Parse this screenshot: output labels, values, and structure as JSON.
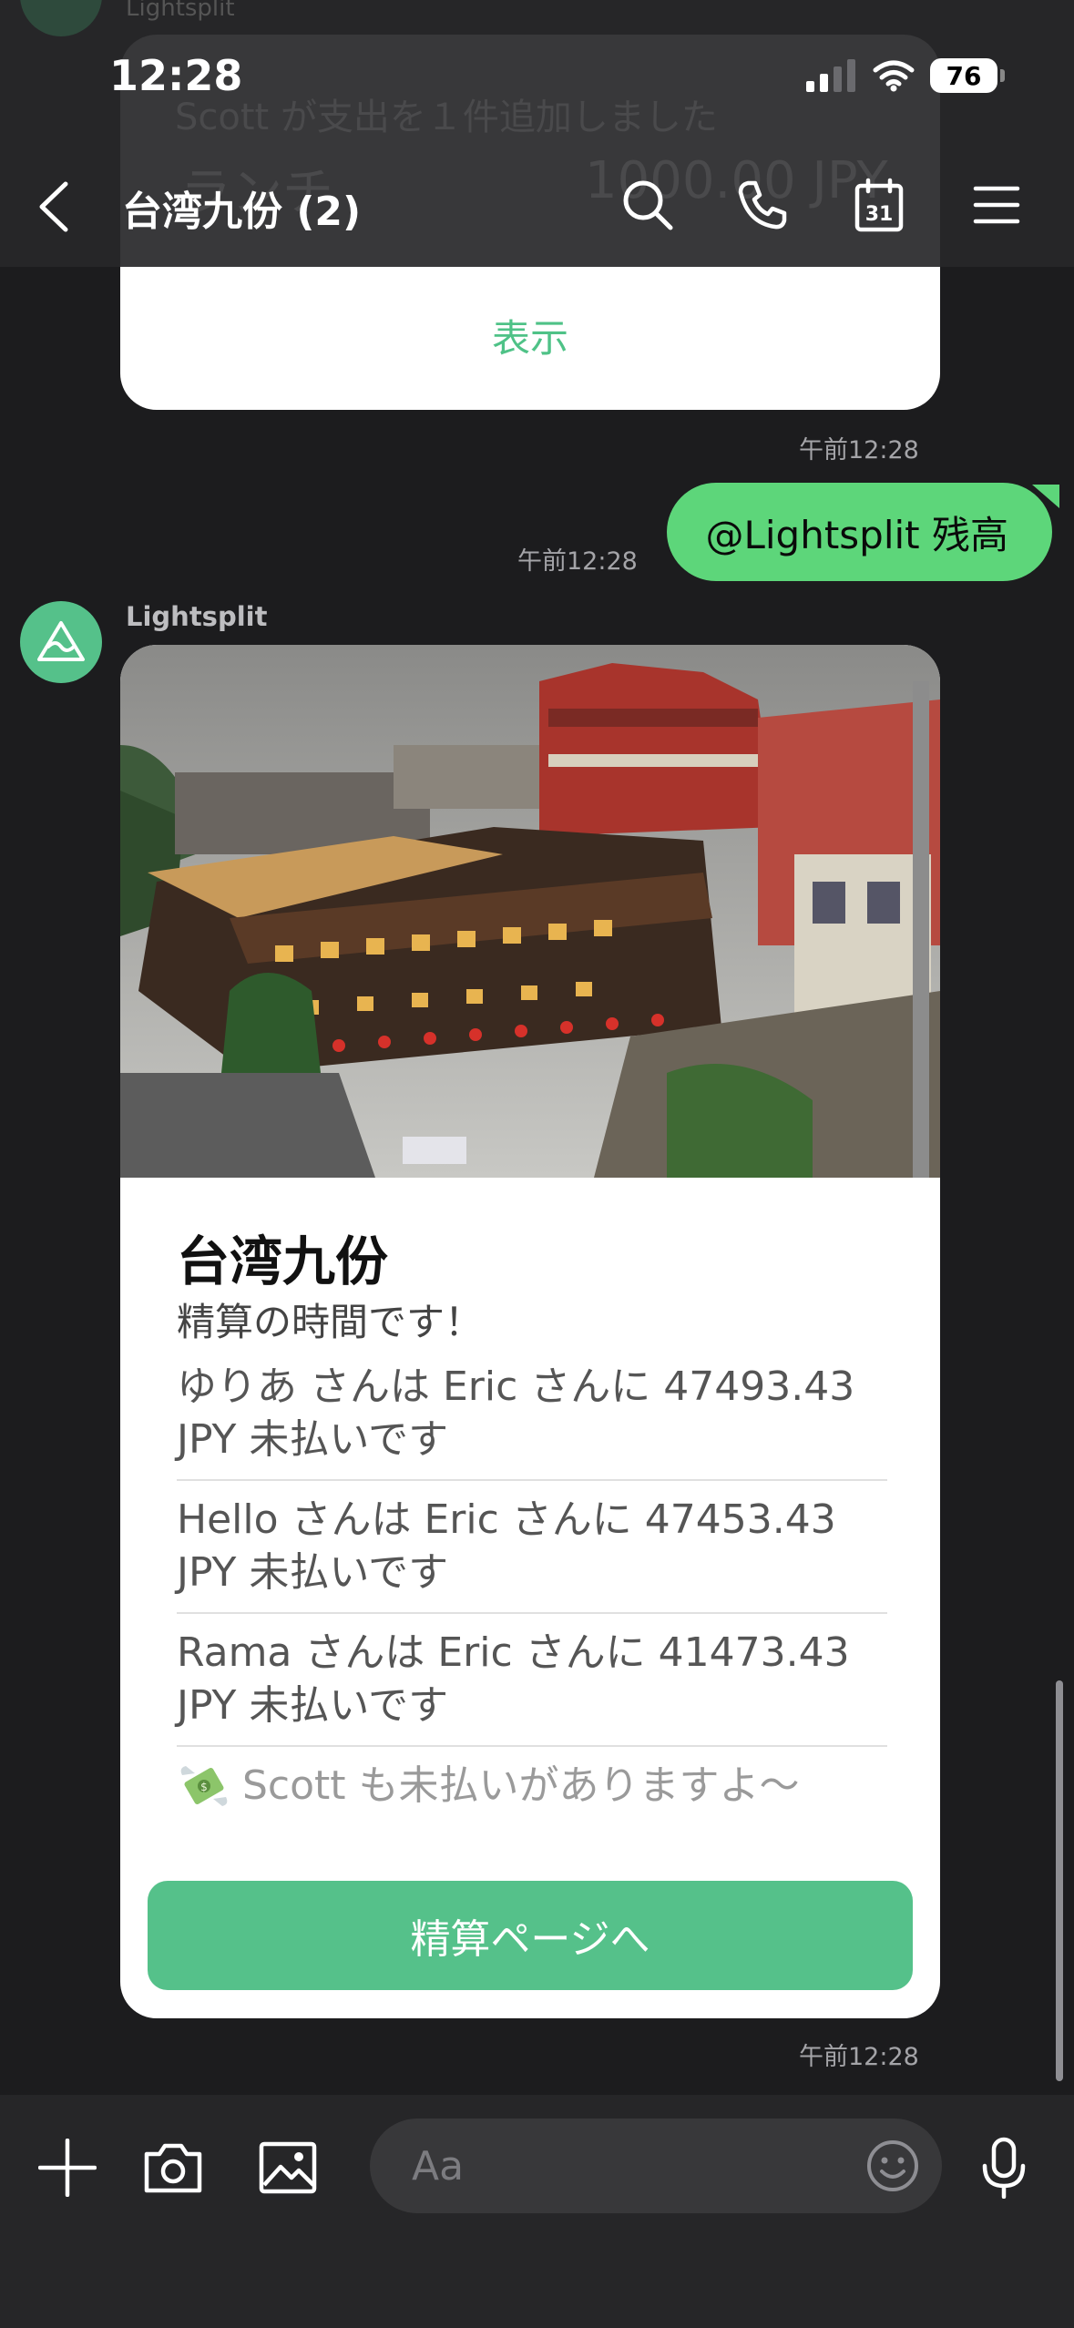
{
  "status_bar": {
    "time": "12:28",
    "battery": "76"
  },
  "ghost": {
    "sender": "Lightsplit",
    "notice": "Scott が支出を１件追加しました",
    "item_label": "ランチ",
    "item_value": "1000.00 JPY"
  },
  "header": {
    "title": "台湾九份 (2)",
    "back_icon": "chevron-left-icon",
    "actions": [
      "search-icon",
      "phone-icon",
      "calendar-icon",
      "menu-icon"
    ],
    "calendar_day": "31"
  },
  "previous_card": {
    "link_label": "表示",
    "timestamp": "午前12:28"
  },
  "outgoing_message": {
    "text": "@Lightsplit 残高",
    "timestamp": "午前12:28",
    "color": "#5dd67a"
  },
  "bot": {
    "name": "Lightsplit",
    "avatar_color": "#55c18a",
    "card": {
      "title": "台湾九份",
      "subtitle": "精算の時間です！",
      "debts": [
        "ゆりあ さんは Eric さんに 47493.43 JPY 未払いです",
        "Hello さんは Eric さんに 47453.43 JPY 未払いです",
        "Rama さんは Eric さんに 41473.43 JPY 未払いです"
      ],
      "extra_icon": "money-with-wings-icon",
      "extra_note": "Scott も未払いがありますよ〜",
      "button_label": "精算ページへ",
      "timestamp": "午前12:28"
    }
  },
  "composer": {
    "placeholder": "Aa",
    "icons": [
      "plus-icon",
      "camera-icon",
      "image-icon",
      "emoji-icon",
      "microphone-icon"
    ]
  },
  "colors": {
    "accent": "#55c18a",
    "background": "#1c1c1e",
    "bar": "#262628"
  }
}
